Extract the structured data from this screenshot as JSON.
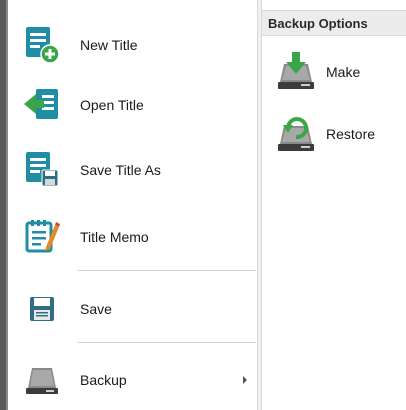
{
  "menu": {
    "items": [
      {
        "label": "New Title",
        "icon": "new-title-icon"
      },
      {
        "label": "Open Title",
        "icon": "open-title-icon"
      },
      {
        "label": "Save Title As",
        "icon": "save-title-as-icon"
      },
      {
        "label": "Title Memo",
        "icon": "title-memo-icon"
      },
      {
        "label": "Save",
        "icon": "save-icon"
      },
      {
        "label": "Backup",
        "icon": "backup-drive-icon",
        "has_submenu": true
      }
    ]
  },
  "submenu": {
    "header": "Backup Options",
    "items": [
      {
        "label": "Make",
        "icon": "make-backup-icon"
      },
      {
        "label": "Restore",
        "icon": "restore-backup-icon"
      }
    ]
  },
  "colors": {
    "accent_teal": "#1f8ea5",
    "accent_green": "#3aa648",
    "drive_dark": "#3c3c3c",
    "strip": "#5a5a5a"
  }
}
